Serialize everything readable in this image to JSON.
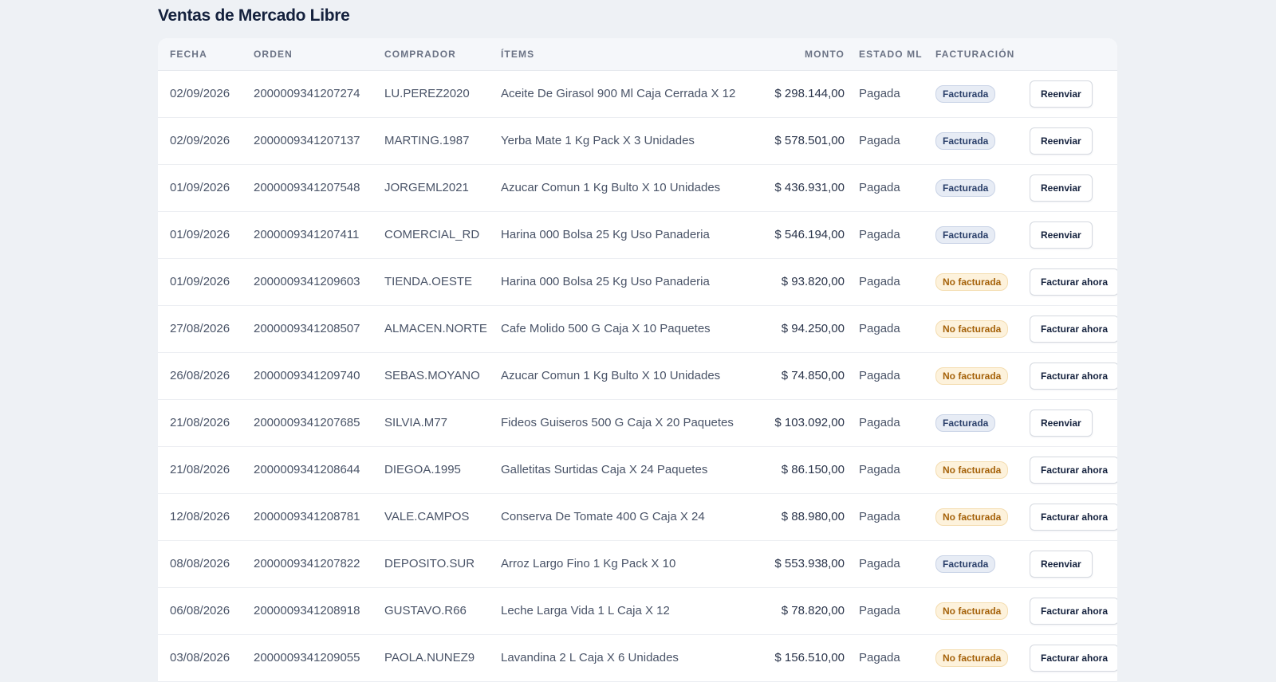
{
  "page": {
    "title": "Ventas de Mercado Libre"
  },
  "table": {
    "headers": {
      "fecha": "FECHA",
      "orden": "ORDEN",
      "comprador": "COMPRADOR",
      "items": "ÍTEMS",
      "monto": "MONTO",
      "estado": "ESTADO ML",
      "facturacion": "FACTURACIÓN"
    },
    "rows": [
      {
        "fecha": "02/09/2026",
        "orden": "2000009341207274",
        "comprador": "LU.PEREZ2020",
        "items": "Aceite De Girasol 900 Ml Caja Cerrada X 12",
        "monto": "$ 298.144,00",
        "estado": "Pagada",
        "facturacion": "Facturada",
        "status": "ok",
        "accion": "Reenviar"
      },
      {
        "fecha": "02/09/2026",
        "orden": "2000009341207137",
        "comprador": "MARTING.1987",
        "items": "Yerba Mate 1 Kg Pack X 3 Unidades",
        "monto": "$ 578.501,00",
        "estado": "Pagada",
        "facturacion": "Facturada",
        "status": "ok",
        "accion": "Reenviar"
      },
      {
        "fecha": "01/09/2026",
        "orden": "2000009341207548",
        "comprador": "JORGEML2021",
        "items": "Azucar Comun 1 Kg Bulto X 10 Unidades",
        "monto": "$ 436.931,00",
        "estado": "Pagada",
        "facturacion": "Facturada",
        "status": "ok",
        "accion": "Reenviar"
      },
      {
        "fecha": "01/09/2026",
        "orden": "2000009341207411",
        "comprador": "COMERCIAL_RD",
        "items": "Harina 000 Bolsa 25 Kg Uso Panaderia",
        "monto": "$ 546.194,00",
        "estado": "Pagada",
        "facturacion": "Facturada",
        "status": "ok",
        "accion": "Reenviar"
      },
      {
        "fecha": "01/09/2026",
        "orden": "2000009341209603",
        "comprador": "TIENDA.OESTE",
        "items": "Harina 000 Bolsa 25 Kg Uso Panaderia",
        "monto": "$ 93.820,00",
        "estado": "Pagada",
        "facturacion": "No facturada",
        "status": "no",
        "accion": "Facturar ahora"
      },
      {
        "fecha": "27/08/2026",
        "orden": "2000009341208507",
        "comprador": "ALMACEN.NORTE",
        "items": "Cafe Molido 500 G Caja X 10 Paquetes",
        "monto": "$ 94.250,00",
        "estado": "Pagada",
        "facturacion": "No facturada",
        "status": "no",
        "accion": "Facturar ahora"
      },
      {
        "fecha": "26/08/2026",
        "orden": "2000009341209740",
        "comprador": "SEBAS.MOYANO",
        "items": "Azucar Comun 1 Kg Bulto X 10 Unidades",
        "monto": "$ 74.850,00",
        "estado": "Pagada",
        "facturacion": "No facturada",
        "status": "no",
        "accion": "Facturar ahora"
      },
      {
        "fecha": "21/08/2026",
        "orden": "2000009341207685",
        "comprador": "SILVIA.M77",
        "items": "Fideos Guiseros 500 G Caja X 20 Paquetes",
        "monto": "$ 103.092,00",
        "estado": "Pagada",
        "facturacion": "Facturada",
        "status": "ok",
        "accion": "Reenviar"
      },
      {
        "fecha": "21/08/2026",
        "orden": "2000009341208644",
        "comprador": "DIEGOA.1995",
        "items": "Galletitas Surtidas Caja X 24 Paquetes",
        "monto": "$ 86.150,00",
        "estado": "Pagada",
        "facturacion": "No facturada",
        "status": "no",
        "accion": "Facturar ahora"
      },
      {
        "fecha": "12/08/2026",
        "orden": "2000009341208781",
        "comprador": "VALE.CAMPOS",
        "items": "Conserva De Tomate 400 G Caja X 24",
        "monto": "$ 88.980,00",
        "estado": "Pagada",
        "facturacion": "No facturada",
        "status": "no",
        "accion": "Facturar ahora"
      },
      {
        "fecha": "08/08/2026",
        "orden": "2000009341207822",
        "comprador": "DEPOSITO.SUR",
        "items": "Arroz Largo Fino 1 Kg Pack X 10",
        "monto": "$ 553.938,00",
        "estado": "Pagada",
        "facturacion": "Facturada",
        "status": "ok",
        "accion": "Reenviar"
      },
      {
        "fecha": "06/08/2026",
        "orden": "2000009341208918",
        "comprador": "GUSTAVO.R66",
        "items": "Leche Larga Vida 1 L Caja X 12",
        "monto": "$ 78.820,00",
        "estado": "Pagada",
        "facturacion": "No facturada",
        "status": "no",
        "accion": "Facturar ahora"
      },
      {
        "fecha": "03/08/2026",
        "orden": "2000009341209055",
        "comprador": "PAOLA.NUNEZ9",
        "items": "Lavandina 2 L Caja X 6 Unidades",
        "monto": "$ 156.510,00",
        "estado": "Pagada",
        "facturacion": "No facturada",
        "status": "no",
        "accion": "Facturar ahora"
      }
    ]
  },
  "colors": {
    "background": "#eef1f5",
    "badge_facturada": "#e7ecf5",
    "badge_no_facturada": "#fdf2dc"
  }
}
